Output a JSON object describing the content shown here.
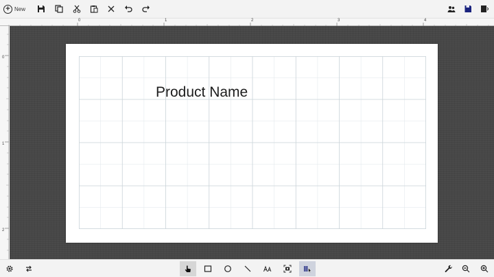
{
  "toolbar_top": {
    "new_label": "New",
    "icons": [
      "save-icon",
      "copy-icon",
      "cut-icon",
      "paste-icon",
      "delete-icon",
      "undo-icon",
      "redo-icon"
    ],
    "right_icons": [
      "people-icon",
      "save-as-icon",
      "more-icon"
    ]
  },
  "rulers": {
    "top_numbers": [
      "0",
      "1",
      "2",
      "3",
      "4"
    ],
    "left_numbers": [
      "0",
      "1",
      "2"
    ]
  },
  "label": {
    "text": "Product Name"
  },
  "toolbar_bottom": {
    "left_icons": [
      "settings-icon",
      "swap-icon"
    ],
    "center_tools": [
      "select-tool-icon",
      "rectangle-tool-icon",
      "ellipse-tool-icon",
      "line-tool-icon",
      "text-tool-icon",
      "image-tool-icon",
      "barcode-tool-icon"
    ],
    "right_icons": [
      "wrench-icon",
      "zoom-out-icon",
      "zoom-in-icon"
    ]
  },
  "colors": {
    "canvas_background": "#474747",
    "toolbar_background": "#f3f3f3",
    "grid_line": "#c9d3d8",
    "active_tool": "#d6d6d6"
  }
}
